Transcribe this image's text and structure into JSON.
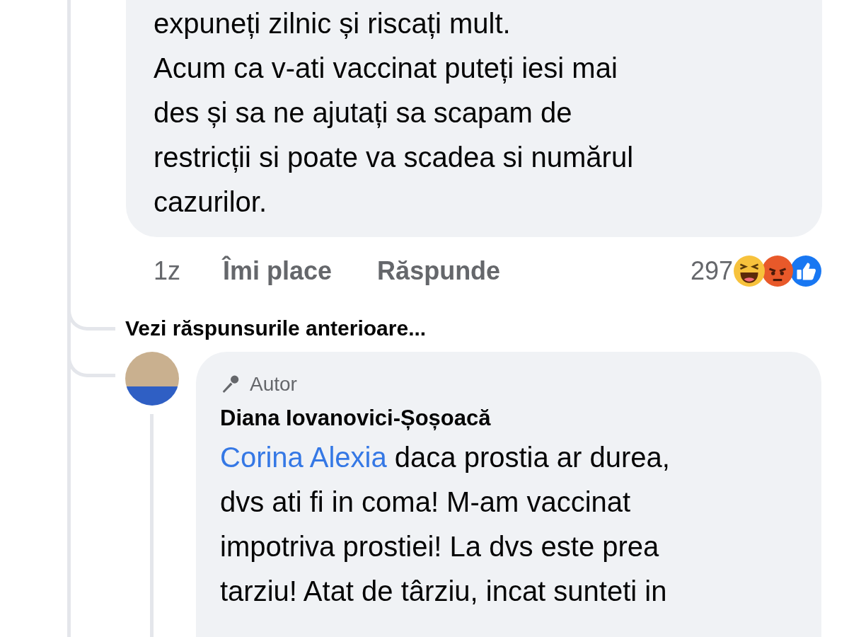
{
  "comment": {
    "text": "expuneți zilnic și riscați mult.\nAcum ca v-ati vaccinat puteți iesi mai\ndes și sa ne ajutați sa scapam de\nrestricții si poate va scadea si numărul\ncazurilor.",
    "time": "1z",
    "like_label": "Îmi place",
    "reply_label": "Răspunde",
    "reaction_count": "297",
    "reactions": [
      {
        "kind": "haha"
      },
      {
        "kind": "angry"
      },
      {
        "kind": "like"
      }
    ]
  },
  "previous_replies_link": "Vezi răspunsurile anterioare...",
  "reply": {
    "badge": "Autor",
    "author": "Diana Iovanovici-Șoșoacă",
    "mention": "Corina Alexia",
    "text": " daca prostia ar durea,\ndvs ati fi in coma! M-am vaccinat\nimpotriva prostiei! La dvs este prea\ntarziu! Atat de târziu, incat sunteti in"
  }
}
